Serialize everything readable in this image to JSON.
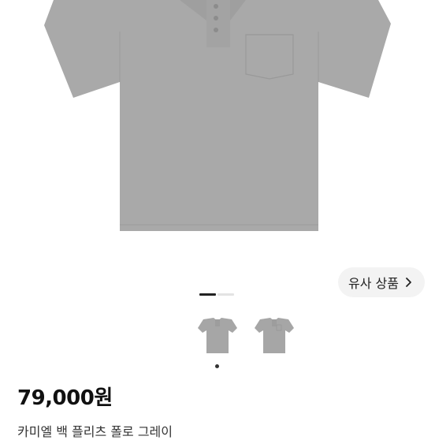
{
  "product_image": {
    "alt": "gray polo shirt"
  },
  "gallery": {
    "count": 2,
    "active_index": 0
  },
  "similar_button": {
    "label": "유사 상품",
    "icon": "chevron-right-icon"
  },
  "thumbnails": [
    {
      "alt": "gray polo shirt thumbnail 1"
    },
    {
      "alt": "gray polo shirt thumbnail 2"
    }
  ],
  "thumbnail_dot": {
    "active_index": 0
  },
  "product": {
    "price": "79,000원",
    "title": "카미엘 백 플리츠 폴로 그레이"
  },
  "colors": {
    "shirt": "#a8a8a8",
    "indicator_active": "#222222",
    "indicator_inactive": "#e3e3e3",
    "button_bg": "#f3f3f3"
  }
}
